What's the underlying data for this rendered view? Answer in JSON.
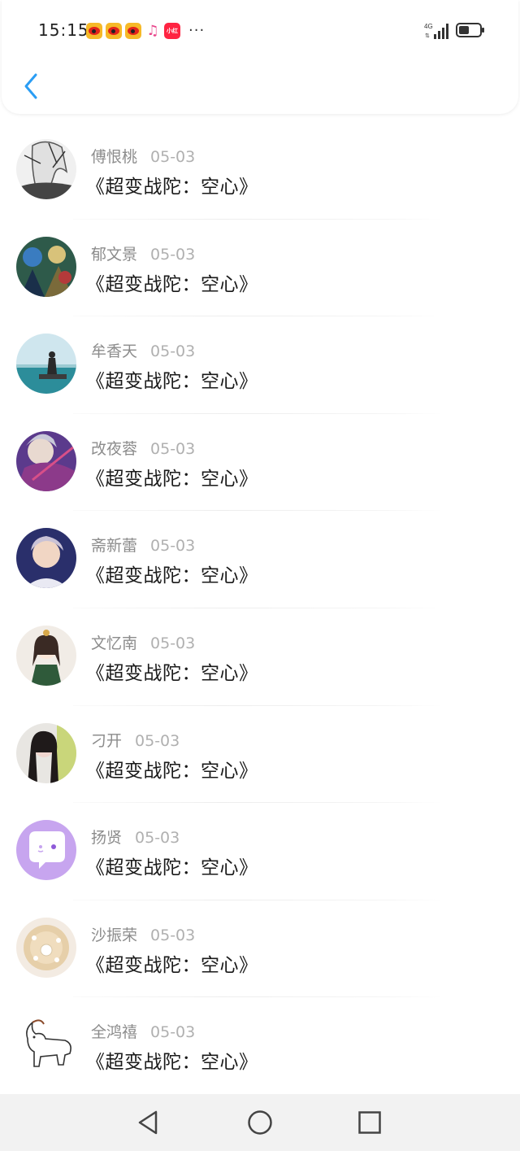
{
  "status_bar": {
    "time": "15:15",
    "notification_icons": [
      "weibo-icon",
      "weibo-icon",
      "weibo-icon",
      "music-icon",
      "xiaohongshu-icon"
    ],
    "more": "···",
    "network_label": "4G",
    "battery_level": 0.5
  },
  "header": {
    "back_icon": "chevron-left-icon",
    "accent_color": "#2a9df4"
  },
  "items": [
    {
      "name": "傅恨桃",
      "date": "05-03",
      "title": "《超变战陀：空心》",
      "avatar": "anime-boy-sketch"
    },
    {
      "name": "郁文景",
      "date": "05-03",
      "title": "《超变战陀：空心》",
      "avatar": "anime-group"
    },
    {
      "name": "牟香天",
      "date": "05-03",
      "title": "《超变战陀：空心》",
      "avatar": "seaside-photo"
    },
    {
      "name": "改夜蓉",
      "date": "05-03",
      "title": "《超变战陀：空心》",
      "avatar": "purple-anime"
    },
    {
      "name": "斋新蕾",
      "date": "05-03",
      "title": "《超变战陀：空心》",
      "avatar": "portrait-blue"
    },
    {
      "name": "文忆南",
      "date": "05-03",
      "title": "《超变战陀：空心》",
      "avatar": "cartoon-girl"
    },
    {
      "name": "刁开",
      "date": "05-03",
      "title": "《超变战陀：空心》",
      "avatar": "girl-photo"
    },
    {
      "name": "扬贤",
      "date": "05-03",
      "title": "《超变战陀：空心》",
      "avatar": "chat-bubble"
    },
    {
      "name": "沙振荣",
      "date": "05-03",
      "title": "《超变战陀：空心》",
      "avatar": "pearl-brooch"
    },
    {
      "name": "全鸿禧",
      "date": "05-03",
      "title": "《超变战陀：空心》",
      "avatar": "goat-drawing"
    }
  ],
  "navbar": {
    "back_icon": "triangle-back-icon",
    "home_icon": "circle-home-icon",
    "recents_icon": "square-recents-icon"
  }
}
